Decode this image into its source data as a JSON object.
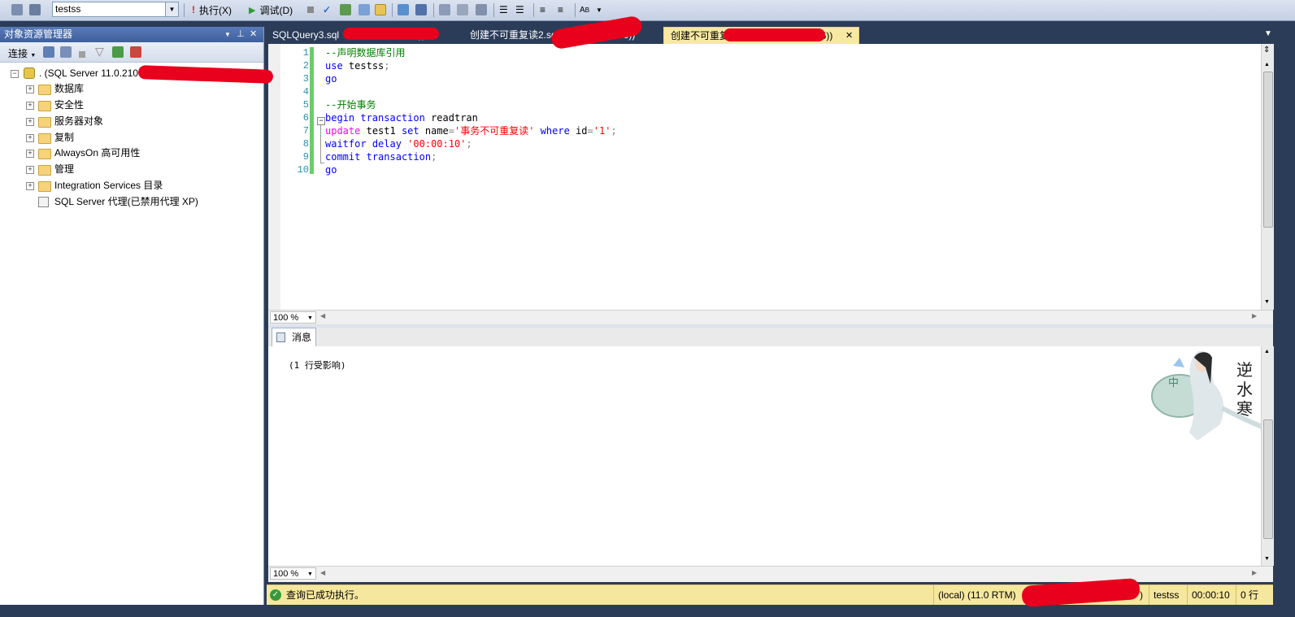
{
  "toolbar": {
    "database": "testss",
    "execute_label": "执行(X)",
    "debug_label": "调试(D)"
  },
  "object_explorer": {
    "title": "对象资源管理器",
    "connect_label": "连接",
    "server_label": ". (SQL Server 11.0.2100",
    "nodes": [
      "数据库",
      "安全性",
      "服务器对象",
      "复制",
      "AlwaysOn 高可用性",
      "管理",
      "Integration Services 目录"
    ],
    "agent_label": "SQL Server 代理(已禁用代理 XP)"
  },
  "tabs": [
    {
      "label": "SQLQuery3.sql",
      "suffix": "))",
      "active": false
    },
    {
      "label": "创建不可重复读2.sq",
      "suffix": "56))",
      "active": false
    },
    {
      "label": "创建不可重复",
      "suffix": "55))",
      "active": true
    }
  ],
  "editor": {
    "lines": [
      {
        "num": "1",
        "text": "--声明数据库引用"
      },
      {
        "num": "2",
        "text": "use testss;"
      },
      {
        "num": "3",
        "text": "go"
      },
      {
        "num": "4",
        "text": ""
      },
      {
        "num": "5",
        "text": "--开始事务"
      },
      {
        "num": "6",
        "text": "begin transaction readtran"
      },
      {
        "num": "7",
        "text": "update test1 set name='事务不可重复读' where id='1';"
      },
      {
        "num": "8",
        "text": "waitfor delay '00:00:10';"
      },
      {
        "num": "9",
        "text": "commit transaction;"
      },
      {
        "num": "10",
        "text": "go"
      }
    ],
    "zoom": "100 %"
  },
  "results": {
    "tab_label": "消息",
    "message": "(1 行受影响)",
    "zoom": "100 %"
  },
  "status": {
    "message": "查询已成功执行。",
    "server": "(local) (11.0 RTM)",
    "server_suffix": ")",
    "database": "testss",
    "elapsed": "00:00:10",
    "rows": "0 行"
  },
  "colors": {
    "keyword": "#0000ff",
    "comment": "#008000",
    "string": "#ff0000",
    "update_keyword": "#ff00ff",
    "line_number": "#2b91af",
    "status_bg": "#f6e79e",
    "tab_active_bg": "#f7e8a2",
    "frame_bg": "#2b3c59"
  }
}
